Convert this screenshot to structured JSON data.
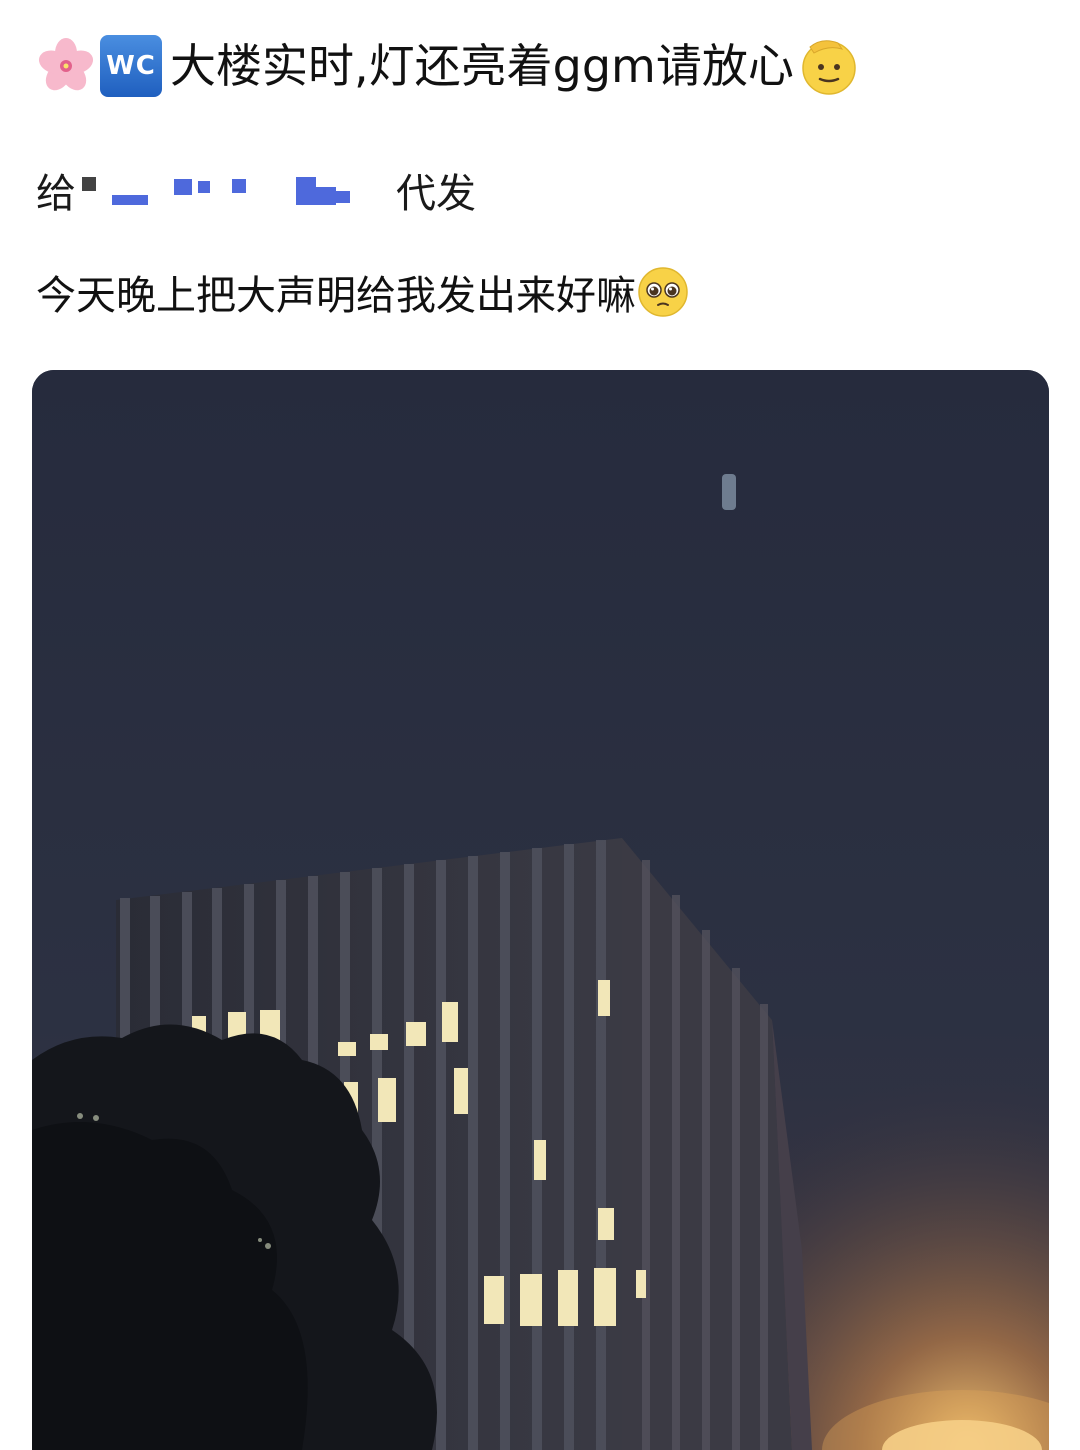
{
  "post": {
    "title_emojis": [
      "cherry-blossom-icon",
      "wc-badge-icon",
      "saluting-face-icon"
    ],
    "wc_label": "WC",
    "title": "大楼实时,灯还亮着ggm请放心",
    "proxy_prefix": "给",
    "proxy_suffix": "代发",
    "message": "今天晚上把大声明给我发出来好嘛",
    "message_emoji": "pleading-face-icon"
  },
  "photo": {
    "subject": "office-building-night-photo"
  },
  "colors": {
    "wc_badge": "#2a6fd0",
    "mosaic": "#2f4fd6",
    "sky": "#2a3042"
  }
}
